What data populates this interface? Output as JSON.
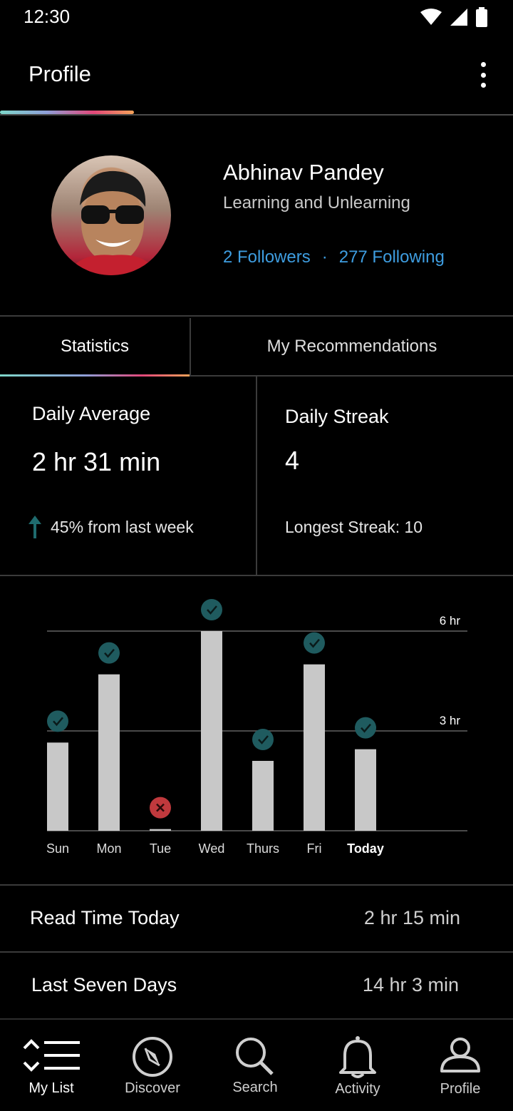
{
  "status_bar": {
    "time": "12:30"
  },
  "app_bar": {
    "title": "Profile"
  },
  "profile": {
    "name": "Abhinav Pandey",
    "bio": "Learning and Unlearning",
    "followers": "2 Followers",
    "separator": "·",
    "following": "277 Following"
  },
  "tabs": [
    {
      "label": "Statistics",
      "active": true
    },
    {
      "label": "My Recommendations",
      "active": false
    }
  ],
  "stats": {
    "daily_average": {
      "label": "Daily Average",
      "value": "2 hr 31 min",
      "change": "45% from last week"
    },
    "daily_streak": {
      "label": "Daily Streak",
      "value": "4",
      "longest": "Longest Streak: 10"
    }
  },
  "chart_data": {
    "type": "bar",
    "categories": [
      "Sun",
      "Mon",
      "Tue",
      "Wed",
      "Thurs",
      "Fri",
      "Today"
    ],
    "values": [
      2.65,
      4.7,
      0.05,
      6.0,
      2.1,
      5.0,
      2.45
    ],
    "status": [
      "met",
      "met",
      "missed",
      "met",
      "met",
      "met",
      "met"
    ],
    "y_ticks": [
      {
        "value": 3,
        "label": "3 hr"
      },
      {
        "value": 6,
        "label": "6 hr"
      }
    ],
    "ylim": [
      0,
      6
    ],
    "colors": {
      "bar": "#c8c8c8",
      "met": "#1f5b5f",
      "missed": "#c0393d",
      "grid": "#4a4a4a"
    }
  },
  "summary": {
    "today": {
      "label": "Read Time Today",
      "value": "2 hr 15 min"
    },
    "week": {
      "label": "Last Seven Days",
      "value": "14 hr 3 min"
    }
  },
  "nav": [
    {
      "label": "My List",
      "icon": "list-icon",
      "active": true
    },
    {
      "label": "Discover",
      "icon": "compass-icon",
      "active": false
    },
    {
      "label": "Search",
      "icon": "search-icon",
      "active": false
    },
    {
      "label": "Activity",
      "icon": "bell-icon",
      "active": false
    },
    {
      "label": "Profile",
      "icon": "person-icon",
      "active": false
    }
  ]
}
